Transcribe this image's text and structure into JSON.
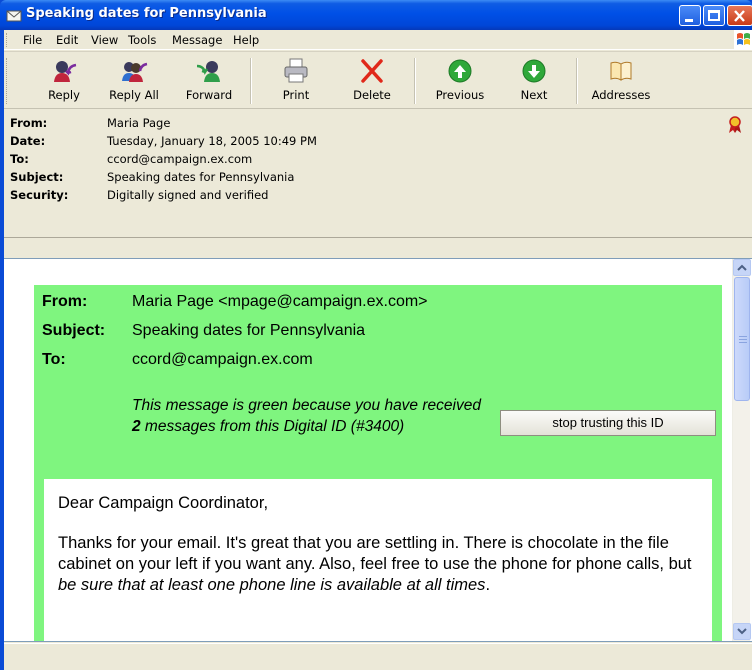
{
  "window": {
    "title": "Speaking dates for Pennsylvania"
  },
  "menu": [
    "File",
    "Edit",
    "View",
    "Tools",
    "Message",
    "Help"
  ],
  "toolbar": {
    "reply": "Reply",
    "reply_all": "Reply All",
    "forward": "Forward",
    "print": "Print",
    "delete": "Delete",
    "previous": "Previous",
    "next": "Next",
    "addresses": "Addresses"
  },
  "headers": {
    "from_label": "From:",
    "from_value": "Maria Page",
    "date_label": "Date:",
    "date_value": "Tuesday, January 18, 2005 10:49 PM",
    "to_label": "To:",
    "to_value": "ccord@campaign.ex.com",
    "subject_label": "Subject:",
    "subject_value": "Speaking dates for Pennsylvania",
    "security_label": "Security:",
    "security_value": "Digitally signed and verified"
  },
  "banner": {
    "from_label": "From:",
    "from_value": "Maria Page <mpage@campaign.ex.com>",
    "subject_label": "Subject:",
    "subject_value": "Speaking dates for Pennsylvania",
    "to_label": "To:",
    "to_value": "ccord@campaign.ex.com",
    "trust_pre": "This message is green because you have received ",
    "trust_count": "2",
    "trust_post": " messages from this Digital ID (#3400)",
    "stop_button": "stop trusting this ID",
    "banner_color": "#7ff57f"
  },
  "body": {
    "greeting": "Dear Campaign Coordinator,",
    "para_plain": "Thanks for your email. It's great that you are settling in. There is chocolate in the file cabinet on your left if you want any. Also, feel free to use the phone for phone calls, but ",
    "para_italic": "be sure that at least one phone line is available at all times",
    "para_end": "."
  },
  "icons": [
    "window-mail-icon",
    "minimize-icon",
    "maximize-icon",
    "close-icon",
    "windows-logo-icon",
    "reply-icon",
    "reply-all-icon",
    "forward-icon",
    "print-icon",
    "delete-icon",
    "previous-icon",
    "next-icon",
    "addresses-icon",
    "certificate-ribbon-icon",
    "scroll-up-icon",
    "scroll-down-icon"
  ]
}
